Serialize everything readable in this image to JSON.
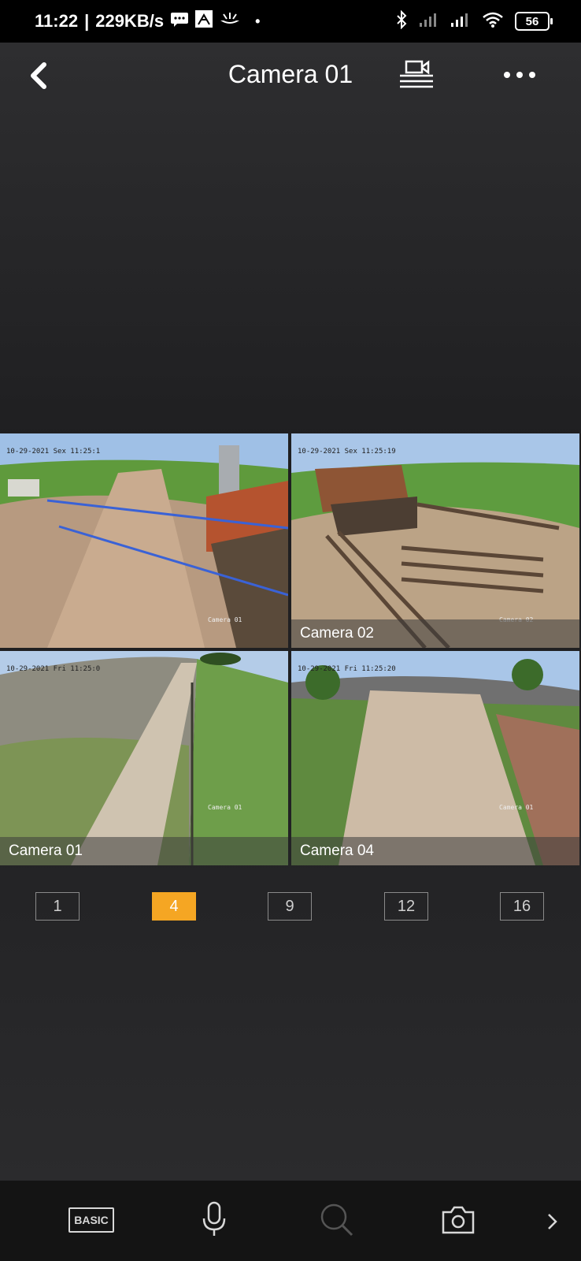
{
  "status_bar": {
    "time": "11:22",
    "speed": "229KB/s",
    "battery": "56"
  },
  "header": {
    "title": "Camera 01"
  },
  "cameras": [
    {
      "caption": "",
      "osd": "10-29-2021 Sex 11:25:1",
      "stamp": "Camera 01"
    },
    {
      "caption": "Camera 02",
      "osd": "10-29-2021 Sex 11:25:19",
      "stamp": "Camera 02"
    },
    {
      "caption": "Camera 01",
      "osd": "10-29-2021 Fri 11:25:0",
      "stamp": "Camera 01"
    },
    {
      "caption": "Camera 04",
      "osd": "10-29-2021 Fri 11:25:20",
      "stamp": "Camera 01"
    }
  ],
  "layout_options": [
    "1",
    "4",
    "9",
    "12",
    "16"
  ],
  "active_layout": "4",
  "bottom_bar": {
    "basic_label": "BASIC"
  },
  "colors": {
    "accent": "#f5a623",
    "background": "#232325",
    "bottom_bar": "#141414"
  }
}
